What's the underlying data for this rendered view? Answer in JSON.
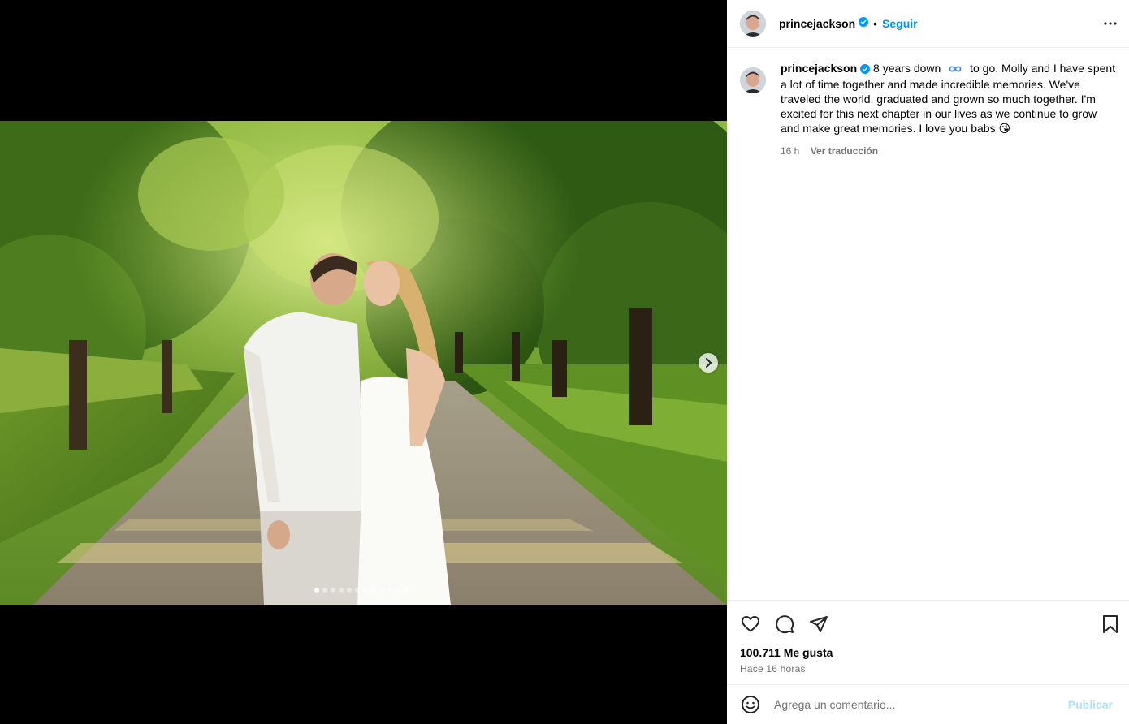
{
  "post": {
    "username": "princejackson",
    "follow_label": "Seguir",
    "separator": "•",
    "caption_part1": "8 years down",
    "caption_part2": "to go. Molly and I have spent a lot of time together and made incredible memories. We've traveled the world, graduated and grown so much together. I'm excited for this next chapter in our lives as we continue to grow and make great memories. I love you babs",
    "caption_emoji": "😘",
    "time_short": "16 h",
    "translate_label": "Ver traducción",
    "likes_text": "100.711 Me gusta",
    "time_long": "Hace 16 horas"
  },
  "comment": {
    "placeholder": "Agrega un comentario...",
    "publish_label": "Publicar"
  },
  "carousel": {
    "total": 12,
    "active_index": 0
  },
  "colors": {
    "accent": "#0095f6",
    "verified": "#0095f6",
    "publish_disabled": "#b2dffc",
    "infinity": "#4a90e2"
  },
  "icons": [
    "more-options-icon",
    "verified-badge-icon",
    "infinity-icon",
    "heart-icon",
    "comment-icon",
    "share-icon",
    "bookmark-icon",
    "emoji-icon",
    "chevron-right-icon"
  ]
}
